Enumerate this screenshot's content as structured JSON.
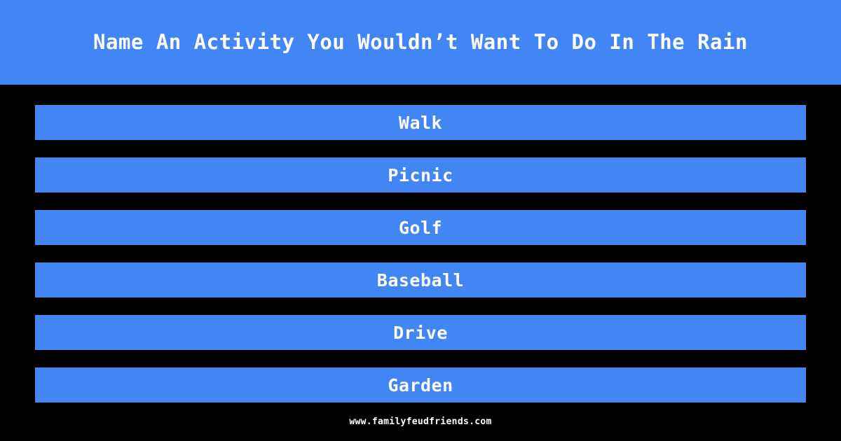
{
  "theme": {
    "background": "#000000",
    "accent": "#4285f4",
    "text": "#ffffff"
  },
  "header": {
    "question": "Name An Activity You Wouldn’t Want To Do In The Rain"
  },
  "answers": [
    {
      "text": "Walk"
    },
    {
      "text": "Picnic"
    },
    {
      "text": "Golf"
    },
    {
      "text": "Baseball"
    },
    {
      "text": "Drive"
    },
    {
      "text": "Garden"
    }
  ],
  "footer": {
    "url": "www.familyfeudfriends.com"
  }
}
